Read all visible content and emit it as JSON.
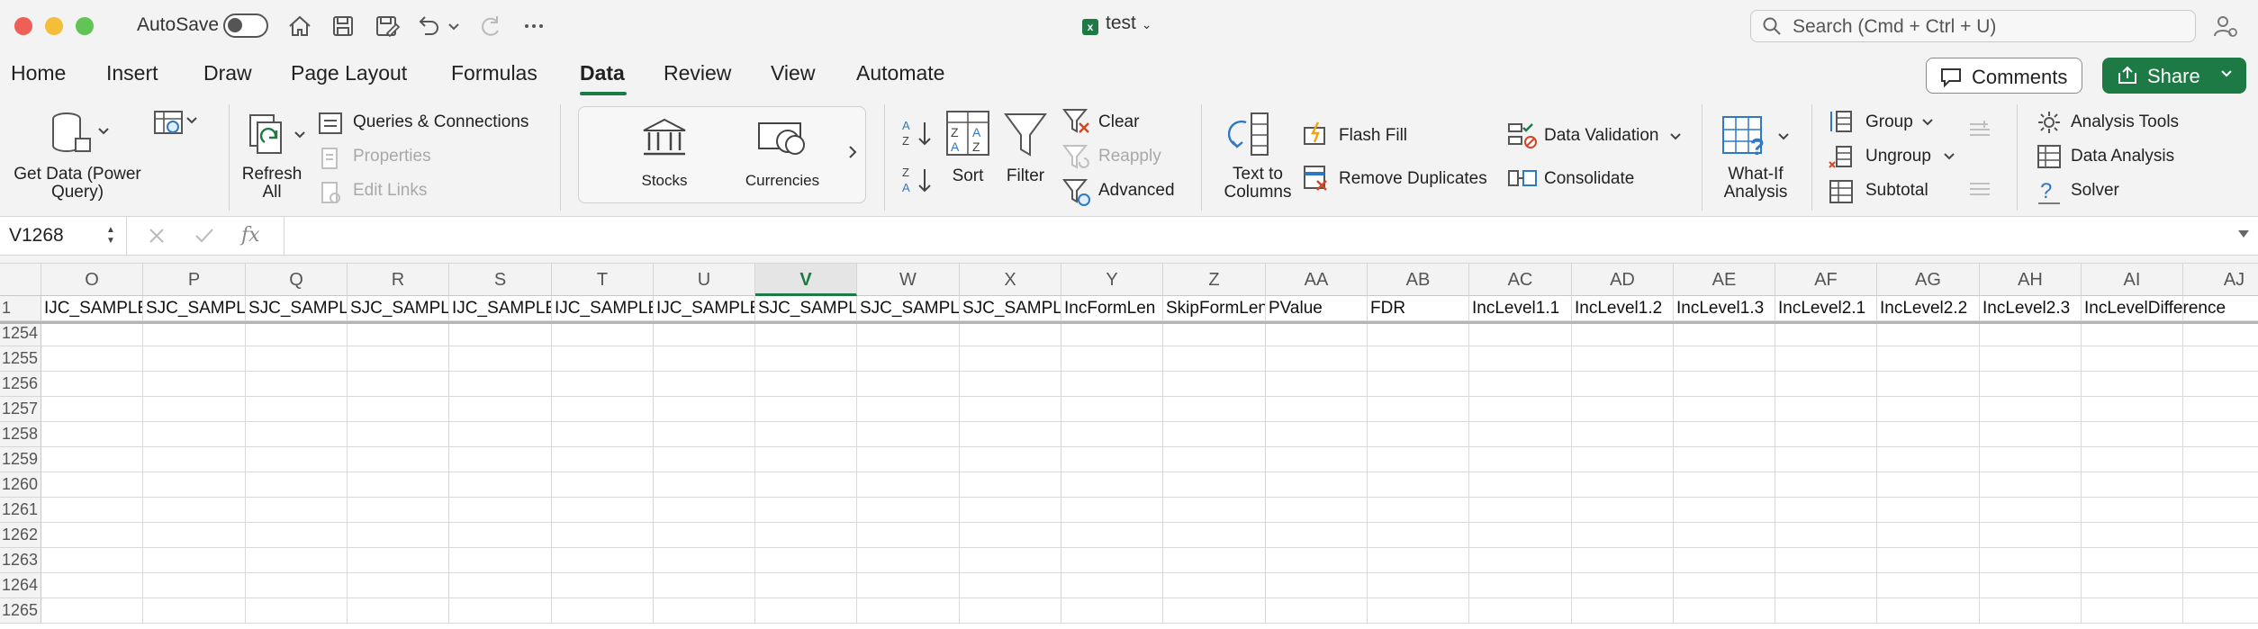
{
  "titlebar": {
    "autosave_label": "AutoSave",
    "doc_title": "test",
    "search_placeholder": "Search (Cmd + Ctrl + U)"
  },
  "tabs": [
    {
      "label": "Home"
    },
    {
      "label": "Insert"
    },
    {
      "label": "Draw"
    },
    {
      "label": "Page Layout"
    },
    {
      "label": "Formulas"
    },
    {
      "label": "Data"
    },
    {
      "label": "Review"
    },
    {
      "label": "View"
    },
    {
      "label": "Automate"
    }
  ],
  "active_tab": "Data",
  "header_buttons": {
    "comments": "Comments",
    "share": "Share"
  },
  "ribbon": {
    "get_data": "Get Data (Power Query)",
    "get_data_l1": "Get Data (Power",
    "get_data_l2": "Query)",
    "refresh_l1": "Refresh",
    "refresh_l2": "All",
    "queries": "Queries & Connections",
    "properties": "Properties",
    "edit_links": "Edit Links",
    "stocks": "Stocks",
    "currencies": "Currencies",
    "sort": "Sort",
    "filter": "Filter",
    "clear": "Clear",
    "reapply": "Reapply",
    "advanced": "Advanced",
    "text_to_columns_l1": "Text to",
    "text_to_columns_l2": "Columns",
    "flash_fill": "Flash Fill",
    "remove_duplicates": "Remove Duplicates",
    "data_validation": "Data Validation",
    "consolidate": "Consolidate",
    "what_if_l1": "What-If",
    "what_if_l2": "Analysis",
    "group": "Group",
    "ungroup": "Ungroup",
    "subtotal": "Subtotal",
    "analysis_tools": "Analysis Tools",
    "data_analysis": "Data Analysis",
    "solver": "Solver"
  },
  "formula_bar": {
    "name_box": "V1268",
    "fx": "fx",
    "formula": ""
  },
  "accent_color": "#1d7a44",
  "grid": {
    "selected_column": "V",
    "columns": [
      {
        "letter": "O",
        "header_cell": "IJC_SAMPLE_"
      },
      {
        "letter": "P",
        "header_cell": "SJC_SAMPLE"
      },
      {
        "letter": "Q",
        "header_cell": "SJC_SAMPLE"
      },
      {
        "letter": "R",
        "header_cell": "SJC_SAMPLE"
      },
      {
        "letter": "S",
        "header_cell": "IJC_SAMPLE_"
      },
      {
        "letter": "T",
        "header_cell": "IJC_SAMPLE_"
      },
      {
        "letter": "U",
        "header_cell": "IJC_SAMPLE_"
      },
      {
        "letter": "V",
        "header_cell": "SJC_SAMPLE"
      },
      {
        "letter": "W",
        "header_cell": "SJC_SAMPLE"
      },
      {
        "letter": "X",
        "header_cell": "SJC_SAMPLE"
      },
      {
        "letter": "Y",
        "header_cell": "IncFormLen"
      },
      {
        "letter": "Z",
        "header_cell": "SkipFormLen"
      },
      {
        "letter": "AA",
        "header_cell": "PValue"
      },
      {
        "letter": "AB",
        "header_cell": "FDR"
      },
      {
        "letter": "AC",
        "header_cell": "IncLevel1.1"
      },
      {
        "letter": "AD",
        "header_cell": "IncLevel1.2"
      },
      {
        "letter": "AE",
        "header_cell": "IncLevel1.3"
      },
      {
        "letter": "AF",
        "header_cell": "IncLevel2.1"
      },
      {
        "letter": "AG",
        "header_cell": "IncLevel2.2"
      },
      {
        "letter": "AH",
        "header_cell": "IncLevel2.3"
      },
      {
        "letter": "AI",
        "header_cell": "IncLevelDifference"
      },
      {
        "letter": "AJ",
        "header_cell": ""
      }
    ],
    "rows": [
      "1",
      "1254",
      "1255",
      "1256",
      "1257",
      "1258",
      "1259",
      "1260",
      "1261",
      "1262",
      "1263",
      "1264",
      "1265"
    ]
  }
}
